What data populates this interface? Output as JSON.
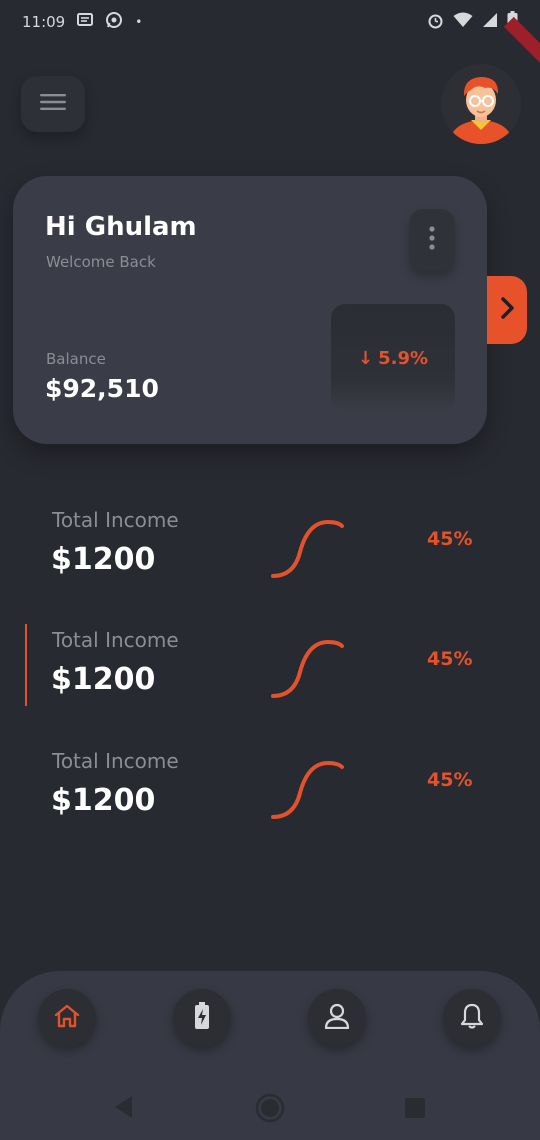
{
  "status_bar": {
    "time": "11:09",
    "dot": "•"
  },
  "header": {
    "menu_icon": "hamburger-menu-icon",
    "avatar_icon": "user-avatar-illustration"
  },
  "card": {
    "greeting": "Hi Ghulam",
    "welcome": "Welcome Back",
    "balance_label": "Balance",
    "balance_value": "$92,510",
    "change_arrow": "↓",
    "change_value": "5.9%"
  },
  "income_rows": [
    {
      "label": "Total Income",
      "value": "$1200",
      "percent": "45%",
      "selected": false
    },
    {
      "label": "Total Income",
      "value": "$1200",
      "percent": "45%",
      "selected": true
    },
    {
      "label": "Total Income",
      "value": "$1200",
      "percent": "45%",
      "selected": false
    }
  ],
  "bottom_nav": {
    "items": [
      "home-icon",
      "battery-charging-icon",
      "user-icon",
      "bell-icon"
    ],
    "active": "home-icon"
  },
  "colors": {
    "background": "#282a31",
    "card": "#3a3d47",
    "accent": "#e2522c",
    "muted_text": "#8b8d96"
  }
}
